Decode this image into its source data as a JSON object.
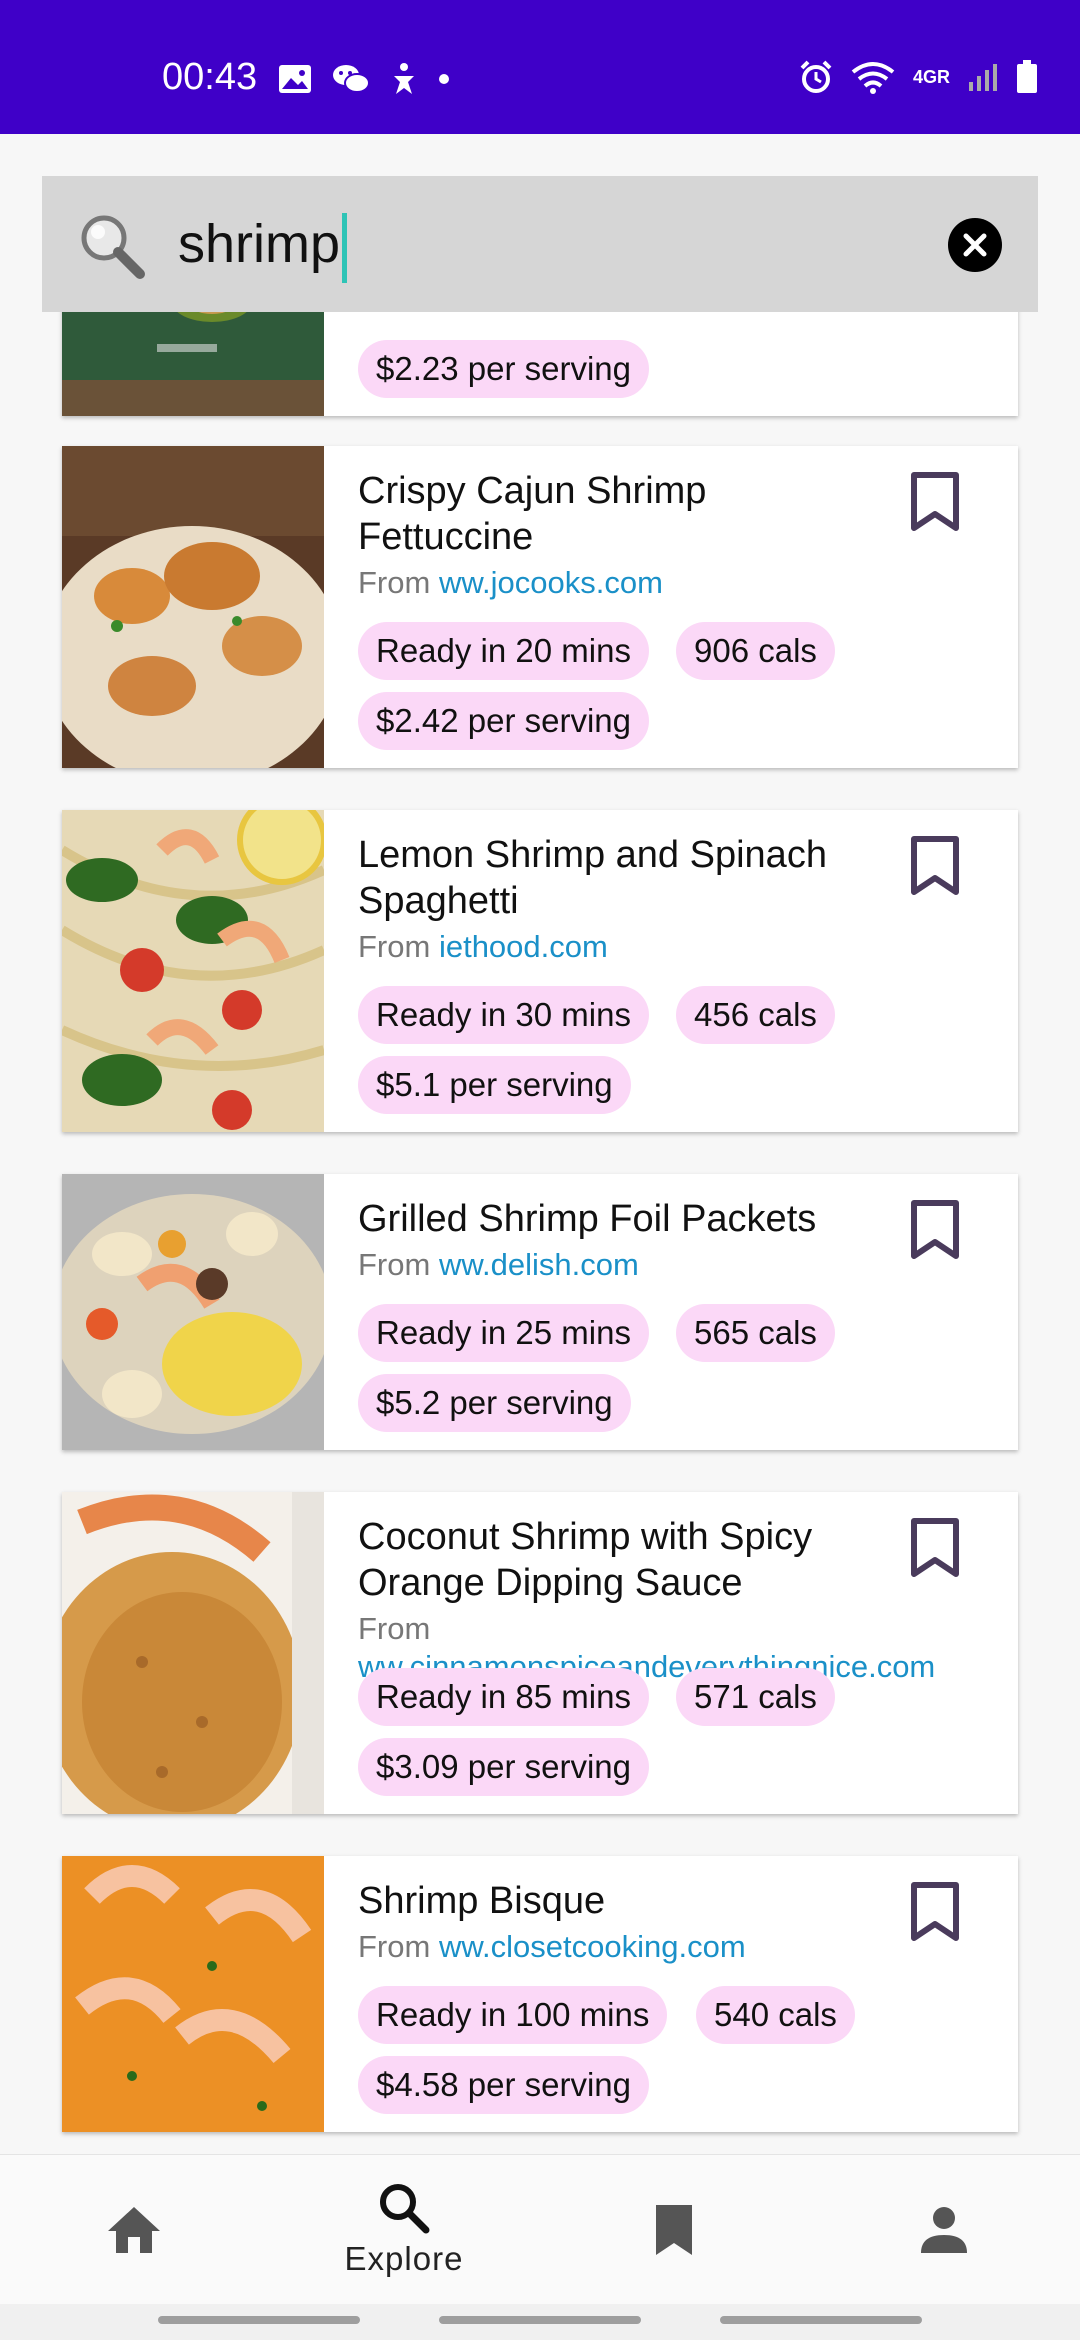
{
  "status_bar": {
    "time": "00:43",
    "network": "4GR",
    "left_icons": [
      "image-icon",
      "wechat-icon",
      "accessibility-icon",
      "dot-icon"
    ],
    "right_icons": [
      "alarm-icon",
      "wifi-icon",
      "signal-icon",
      "battery-icon"
    ]
  },
  "search": {
    "query": "shrimp",
    "icon": "search-icon",
    "clear_icon": "close-icon"
  },
  "recipes": [
    {
      "title": "",
      "from_label": "",
      "source": "",
      "ready": "",
      "cals": "",
      "price": "$2.23 per serving"
    },
    {
      "title": "Crispy Cajun Shrimp Fettuccine",
      "from_label": "From",
      "source": "ww.jocooks.com",
      "ready": "Ready in 20 mins",
      "cals": "906 cals",
      "price": "$2.42 per serving"
    },
    {
      "title": "Lemon Shrimp and Spinach Spaghetti",
      "from_label": "From",
      "source": "iethood.com",
      "ready": "Ready in 30 mins",
      "cals": "456 cals",
      "price": "$5.1 per serving"
    },
    {
      "title": "Grilled Shrimp Foil Packets",
      "from_label": "From",
      "source": "ww.delish.com",
      "ready": "Ready in 25 mins",
      "cals": "565 cals",
      "price": "$5.2 per serving"
    },
    {
      "title": "Coconut Shrimp with Spicy Orange Dipping Sauce",
      "from_label": "From",
      "source": "ww.cinnamonspiceandeverythingnice.com",
      "ready": "Ready in 85 mins",
      "cals": "571 cals",
      "price": "$3.09 per serving"
    },
    {
      "title": "Shrimp Bisque",
      "from_label": "From",
      "source": "ww.closetcooking.com",
      "ready": "Ready in 100 mins",
      "cals": "540 cals",
      "price": "$4.58 per serving"
    }
  ],
  "bottom_nav": {
    "items": [
      {
        "icon": "home-icon",
        "label": ""
      },
      {
        "icon": "search-icon",
        "label": "Explore"
      },
      {
        "icon": "bookmark-icon",
        "label": ""
      },
      {
        "icon": "person-icon",
        "label": ""
      }
    ],
    "active": "Explore"
  },
  "colors": {
    "status_bar": "#3f00c8",
    "chip": "#fbd8f7",
    "link": "#1a90c8",
    "bookmark": "#4a3b5c",
    "caret": "#2ec4b6"
  }
}
